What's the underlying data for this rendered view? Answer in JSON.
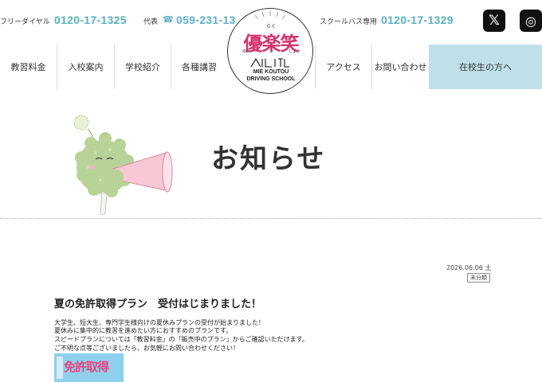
{
  "header": {
    "freedial_label": "フリーダイヤル",
    "freedial_number": "0120-17-1325",
    "main_label": "代表",
    "main_number": "059-231-13",
    "bus_label": "スクールバス専用",
    "bus_number": "0120-17-1329",
    "social": {
      "x_glyph": "𝕏",
      "instagram_glyph": "◎"
    }
  },
  "logo": {
    "ruby_top": "らく",
    "kanji": "優楽笑",
    "ruby_left": "ゆう",
    "ruby_right": "しょう",
    "line1": "MIE KOUTOU",
    "line2": "DRIVING SCHOOL"
  },
  "nav": {
    "items": [
      "教習料金",
      "入校案内",
      "学校紹介",
      "各種講習",
      "アクセス",
      "お問い合わせ"
    ],
    "cta": "在校生の方へ"
  },
  "page": {
    "title": "お知らせ"
  },
  "post": {
    "date": "2026.06.06 土",
    "category": "未分類",
    "title": "夏の免許取得プラン　受付はじまりました！",
    "body": [
      "大学生、短大生、専門学生様向けの夏休みプランの受付が始まりました！",
      "夏休みに集中的に教習を進めたい方におすすめのプランです。",
      "スピードプランについては「教習料金」の「販売中のプラン」からご確認いただけます。",
      "ご不明な点等ございましたら、お気軽にお問い合わせください！"
    ],
    "banner_text": "免許取得"
  },
  "colors": {
    "accent": "#5bb0c4",
    "cta_bg": "#bfe0e9",
    "mascot": "#b8d398"
  }
}
